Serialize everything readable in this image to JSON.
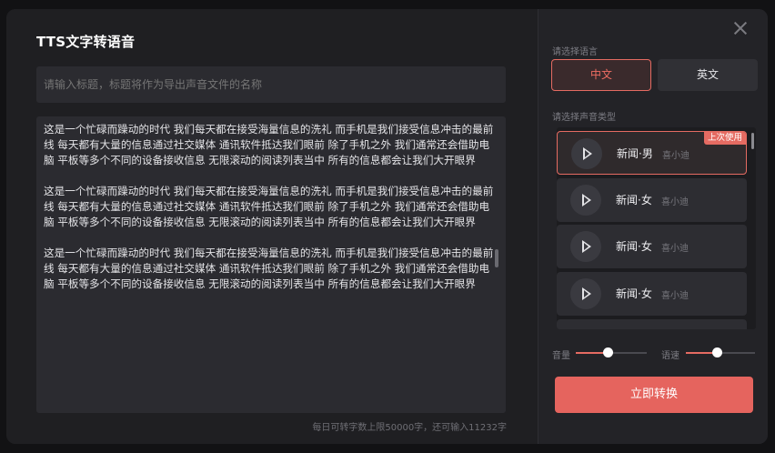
{
  "dialog": {
    "title": "TTS文字转语音",
    "title_placeholder": "请输入标题，标题将作为导出声音文件的名称",
    "paragraphs": [
      "这是一个忙碌而躁动的时代 我们每天都在接受海量信息的洗礼 而手机是我们接受信息冲击的最前线 每天都有大量的信息通过社交媒体 通讯软件抵达我们眼前 除了手机之外 我们通常还会借助电脑 平板等多个不同的设备接收信息 无限滚动的阅读列表当中 所有的信息都会让我们大开眼界",
      "这是一个忙碌而躁动的时代 我们每天都在接受海量信息的洗礼 而手机是我们接受信息冲击的最前线 每天都有大量的信息通过社交媒体 通讯软件抵达我们眼前 除了手机之外 我们通常还会借助电脑 平板等多个不同的设备接收信息 无限滚动的阅读列表当中 所有的信息都会让我们大开眼界",
      "这是一个忙碌而躁动的时代 我们每天都在接受海量信息的洗礼 而手机是我们接受信息冲击的最前线 每天都有大量的信息通过社交媒体 通讯软件抵达我们眼前 除了手机之外 我们通常还会借助电脑 平板等多个不同的设备接收信息 无限滚动的阅读列表当中 所有的信息都会让我们大开眼界"
    ],
    "counter": "每日可转字数上限50000字，还可输入11232字"
  },
  "settings": {
    "language_label": "请选择语言",
    "languages": [
      {
        "label": "中文",
        "selected": true
      },
      {
        "label": "英文",
        "selected": false
      }
    ],
    "voice_label": "请选择声音类型",
    "voices": [
      {
        "name": "新闻·男",
        "sub": "喜小迪",
        "badge": "上次使用",
        "selected": true
      },
      {
        "name": "新闻·女",
        "sub": "喜小迪",
        "badge": "",
        "selected": false
      },
      {
        "name": "新闻·女",
        "sub": "喜小迪",
        "badge": "",
        "selected": false
      },
      {
        "name": "新闻·女",
        "sub": "喜小迪",
        "badge": "",
        "selected": false
      }
    ],
    "volume_label": "音量",
    "volume_level": 0.45,
    "speed_label": "语速",
    "speed_level": 0.45,
    "convert_label": "立即转换"
  },
  "colors": {
    "accent": "#e5645e",
    "panel": "#232327",
    "input": "#2b2b30"
  },
  "icons": {
    "close": "close-icon",
    "play": "play-icon"
  }
}
